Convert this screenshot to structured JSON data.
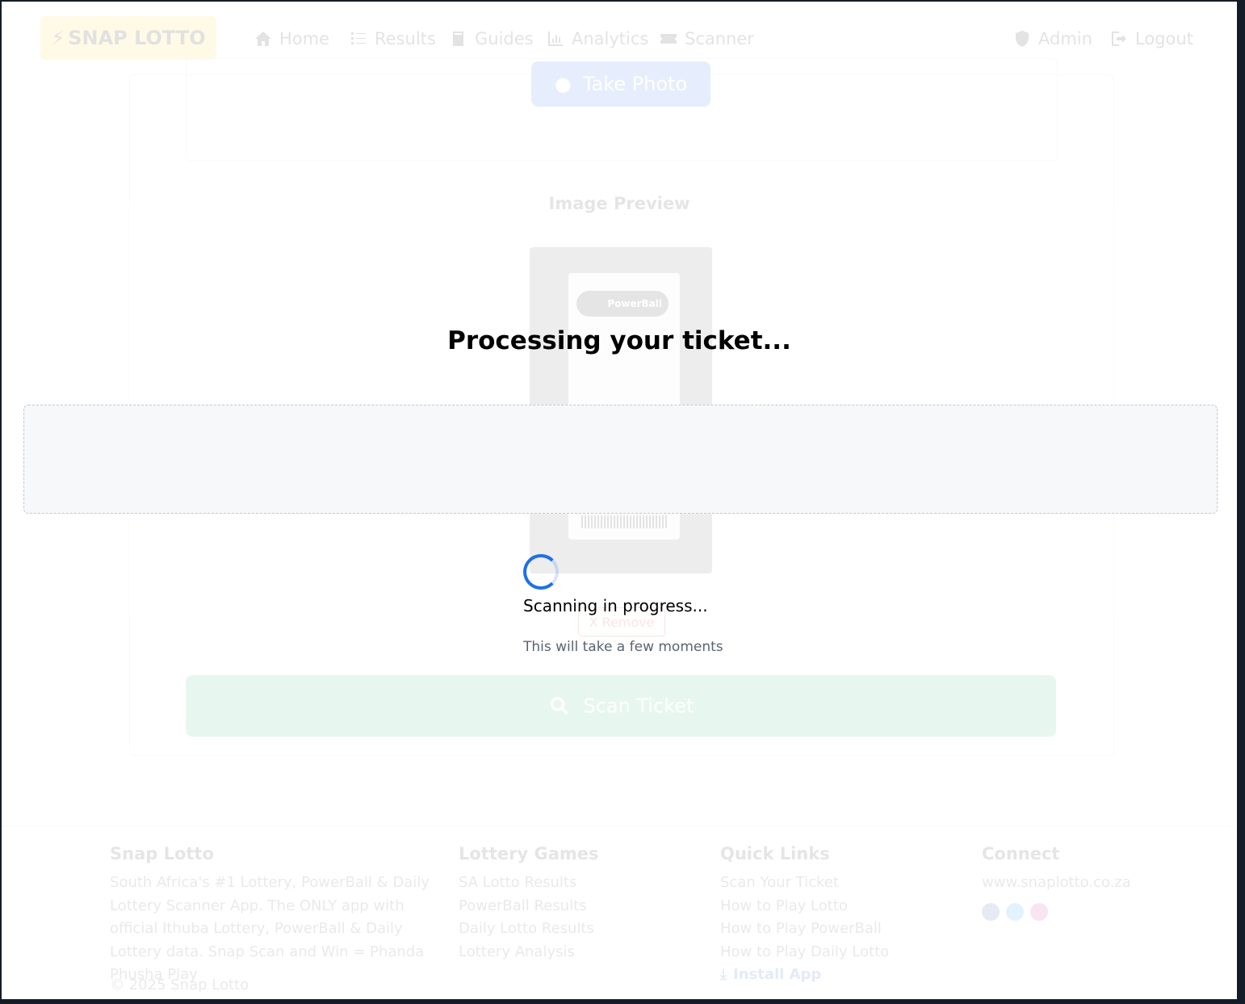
{
  "navbar": {
    "brand": "SNAP LOTTO",
    "links": [
      {
        "label": "Home",
        "icon": "home-icon"
      },
      {
        "label": "Results",
        "icon": "list-icon"
      },
      {
        "label": "Guides",
        "icon": "book-icon"
      },
      {
        "label": "Analytics",
        "icon": "chart-icon"
      },
      {
        "label": "Scanner",
        "icon": "ticket-icon"
      }
    ],
    "admin": "Admin",
    "logout": "Logout"
  },
  "scanner": {
    "take_photo": "Take Photo",
    "preview_title": "Image Preview",
    "ticket_logo_text": "PowerBall",
    "remove": "X Remove",
    "scan_ticket": "Scan Ticket"
  },
  "overlay": {
    "title": "Processing your ticket...",
    "status": "Scanning in progress...",
    "subtext": "This will take a few moments"
  },
  "footer": {
    "about": {
      "title": "Snap Lotto",
      "text": "South Africa's #1 Lottery, PowerBall & Daily Lottery Scanner App. The ONLY app with official Ithuba Lottery, PowerBall & Daily Lottery data. Snap Scan and Win = Phanda Phusha Play"
    },
    "games": {
      "title": "Lottery Games",
      "links": [
        "SA Lotto Results",
        "PowerBall Results",
        "Daily Lotto Results",
        "Lottery Analysis"
      ]
    },
    "quick": {
      "title": "Quick Links",
      "links": [
        "Scan Your Ticket",
        "How to Play Lotto",
        "How to Play PowerBall",
        "How to Play Daily Lotto"
      ],
      "install": "Install App"
    },
    "connect": {
      "title": "Connect",
      "site": "www.snaplotto.co.za",
      "icons": [
        "facebook-icon",
        "twitter-icon",
        "instagram-icon"
      ]
    },
    "copyright": "© 2025 Snap Lotto"
  },
  "colors": {
    "accent_blue": "#1f6feb",
    "brand_yellow": "#ffd93b",
    "scan_green": "#3fbf8a"
  }
}
